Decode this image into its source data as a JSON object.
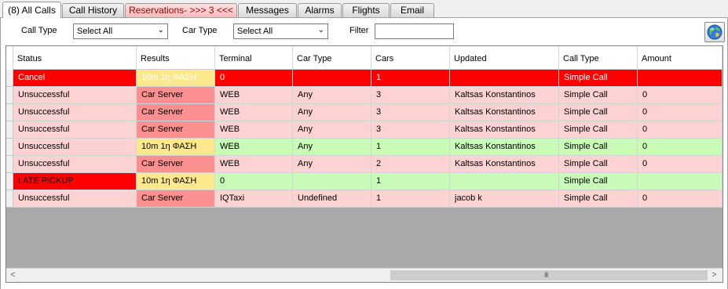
{
  "tabs": [
    {
      "label": "(8) All Calls",
      "active": true
    },
    {
      "label": "Call History"
    },
    {
      "label": "Reservations- >>> 3 <<<",
      "alert": true
    },
    {
      "label": "Messages"
    },
    {
      "label": "Alarms"
    },
    {
      "label": "Flights"
    },
    {
      "label": "Email"
    }
  ],
  "filters": {
    "call_type_label": "Call Type",
    "call_type_value": "Select All",
    "car_type_label": "Car Type",
    "car_type_value": "Select All",
    "filter_label": "Filter",
    "filter_value": ""
  },
  "toolbar": {
    "globe_icon": "globe-icon"
  },
  "grid": {
    "columns": [
      "Status",
      "Results",
      "Terminal",
      "Car Type",
      "Cars",
      "Updated",
      "Call Type",
      "Amount"
    ],
    "rows": [
      {
        "cells": [
          "Cancel",
          "10m 1η ΦΑΣΗ",
          "0",
          "",
          "1",
          "",
          "Simple Call",
          ""
        ]
      },
      {
        "cells": [
          "Unsuccessful",
          "Car Server",
          "WEB",
          "Any",
          "3",
          "Kaltsas Konstantinos",
          "Simple Call",
          "0"
        ]
      },
      {
        "cells": [
          "Unsuccessful",
          "Car Server",
          "WEB",
          "Any",
          "3",
          "Kaltsas Konstantinos",
          "Simple Call",
          "0"
        ]
      },
      {
        "cells": [
          "Unsuccessful",
          "Car Server",
          "WEB",
          "Any",
          "3",
          "Kaltsas Konstantinos",
          "Simple Call",
          "0"
        ]
      },
      {
        "cells": [
          "Unsuccessful",
          "10m 1η ΦΑΣΗ",
          "WEB",
          "Any",
          "1",
          "Kaltsas Konstantinos",
          "Simple Call",
          "0"
        ]
      },
      {
        "cells": [
          "Unsuccessful",
          "Car Server",
          "WEB",
          "Any",
          "2",
          "Kaltsas Konstantinos",
          "Simple Call",
          "0"
        ]
      },
      {
        "cells": [
          "LATE PICKUP",
          "10m 1η ΦΑΣΗ",
          "0",
          "",
          "1",
          "",
          "Simple Call",
          ""
        ]
      },
      {
        "cells": [
          "Unsuccessful",
          "Car Server",
          "IQTaxi",
          "Undefined",
          "1",
          "jacob k",
          "Simple Call",
          "0"
        ]
      }
    ]
  },
  "scrollbar": {
    "left_arrow": "<",
    "right_arrow": ">",
    "grip": "III"
  },
  "colors": {
    "row_pink": "#fcd2d2",
    "row_green": "#c9fbb8",
    "row_red": "#fe0000",
    "car_server": "#fc8f8f",
    "phase_yellow": "#fde88d"
  }
}
